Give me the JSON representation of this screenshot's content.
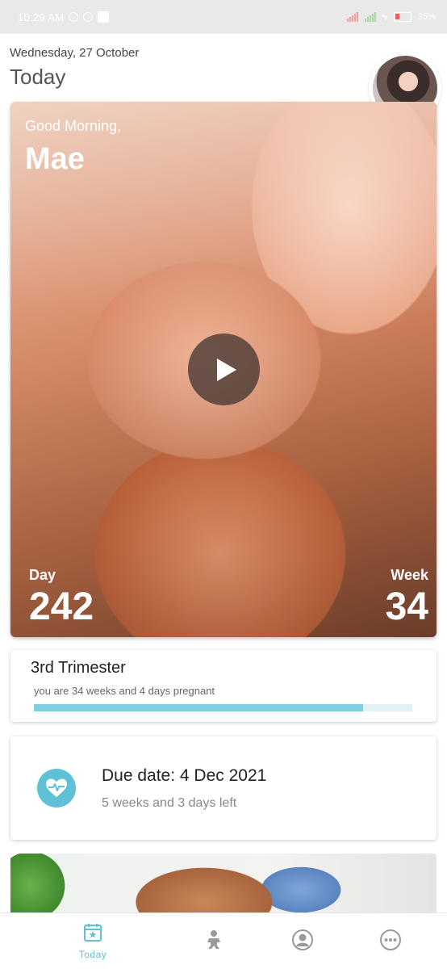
{
  "status_bar": {
    "time": "10:29 AM",
    "battery": "25%"
  },
  "header": {
    "date": "Wednesday, 27 October",
    "title": "Today"
  },
  "hero": {
    "greeting": "Good Morning,",
    "name": "Mae",
    "day_label": "Day",
    "day_value": "242",
    "week_label": "Week",
    "week_value": "34"
  },
  "trimester": {
    "title": "3rd Trimester",
    "subtitle": "you are 34 weeks and 4 days pregnant",
    "progress": 0.87
  },
  "due": {
    "title": "Due date: 4 Dec 2021",
    "subtitle": "5 weeks and 3 days left"
  },
  "nav": {
    "items": [
      {
        "label": "Today",
        "icon": "calendar-star-icon",
        "active": true
      },
      {
        "label": "",
        "icon": "baby-icon",
        "active": false
      },
      {
        "label": "",
        "icon": "community-icon",
        "active": false
      },
      {
        "label": "",
        "icon": "more-icon",
        "active": false
      }
    ]
  },
  "colors": {
    "accent": "#5fc1d7",
    "progress_fill": "#7ecfdf",
    "progress_track": "#e1f1f5",
    "inactive_icon": "#9a9a9a"
  }
}
